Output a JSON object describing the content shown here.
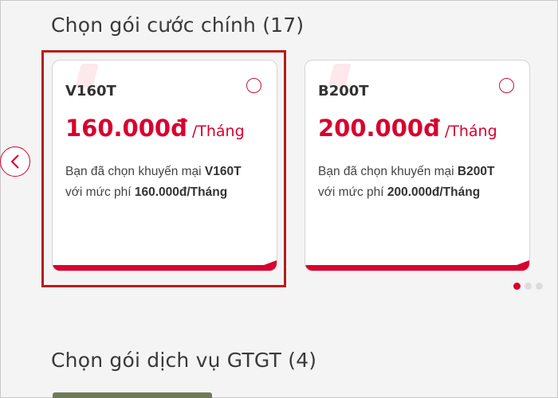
{
  "main_section": {
    "title": "Chọn gói cước chính (17)"
  },
  "packages": [
    {
      "name": "V160T",
      "price": "160.000đ",
      "unit": "/Tháng",
      "desc_prefix": "Bạn đã chọn khuyến mại ",
      "desc_code": "V160T",
      "desc_middle": "với mức phí ",
      "desc_fee": "160.000đ/Tháng",
      "selected": true
    },
    {
      "name": "B200T",
      "price": "200.000đ",
      "unit": "/Tháng",
      "desc_prefix": "Bạn đã chọn khuyến mại ",
      "desc_code": "B200T",
      "desc_middle": "với mức phí ",
      "desc_fee": "200.000đ/Tháng",
      "selected": false
    }
  ],
  "carousel": {
    "prev_icon": "chevron-left-icon",
    "pages": 3,
    "current_page": 1
  },
  "vas_section": {
    "title": "Chọn gói dịch vụ GTGT (4)"
  },
  "colors": {
    "accent": "#d8002f",
    "selected_outline": "#b71c1c"
  }
}
